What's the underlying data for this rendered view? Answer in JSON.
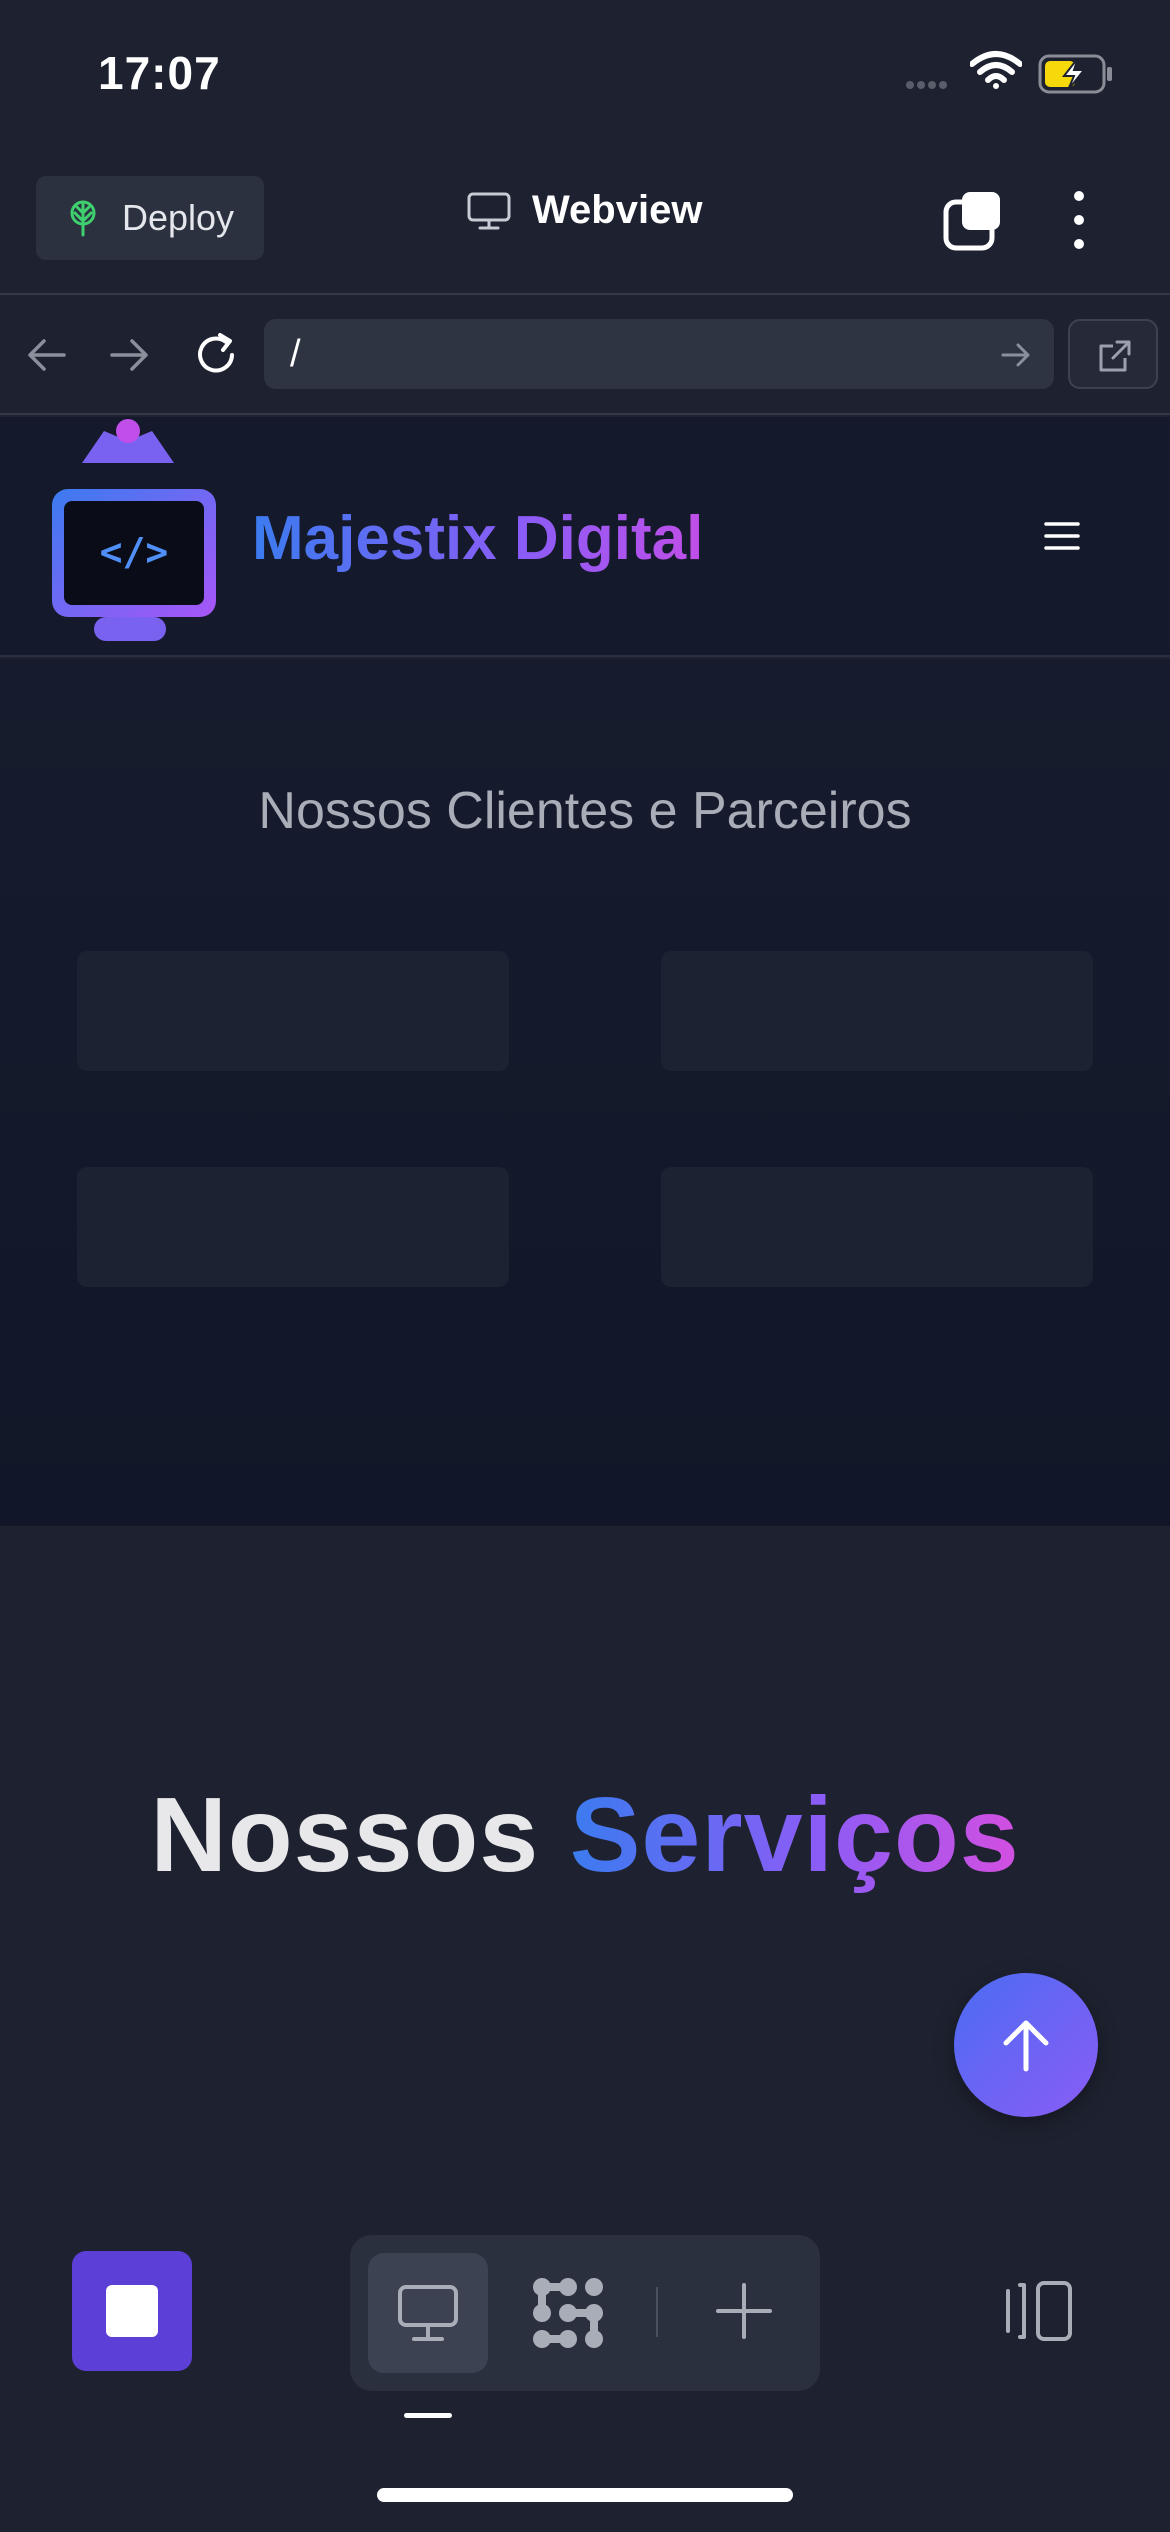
{
  "status_bar": {
    "time": "17:07",
    "icons": [
      "signal-dots-icon",
      "wifi-icon",
      "battery-charging-icon"
    ],
    "battery_color": "#f5d90a"
  },
  "app_header": {
    "deploy_label": "Deploy",
    "title": "Webview",
    "icons": [
      "deploy-icon",
      "monitor-icon",
      "tabs-icon",
      "kebab-menu-icon"
    ]
  },
  "address_bar": {
    "url": "/",
    "icons": [
      "back-arrow-icon",
      "forward-arrow-icon",
      "reload-icon",
      "go-arrow-icon",
      "open-external-icon"
    ]
  },
  "site": {
    "brand": "Majestix Digital",
    "logo_code": "</>",
    "clients_title": "Nossos Clientes e Parceiros",
    "client_logo_slots": 4,
    "services_title_part1": "Nossos",
    "services_title_part2": "Serviços",
    "colors": {
      "gradient_blue": "#3b7bf0",
      "gradient_purple": "#8b5cf6",
      "gradient_pink": "#c14ee8"
    }
  },
  "bottom_bar": {
    "icons": [
      "stop-icon",
      "desktop-icon",
      "dots-grid-icon",
      "plus-icon",
      "panel-layout-icon"
    ],
    "accent_color": "#5b3fd6"
  }
}
